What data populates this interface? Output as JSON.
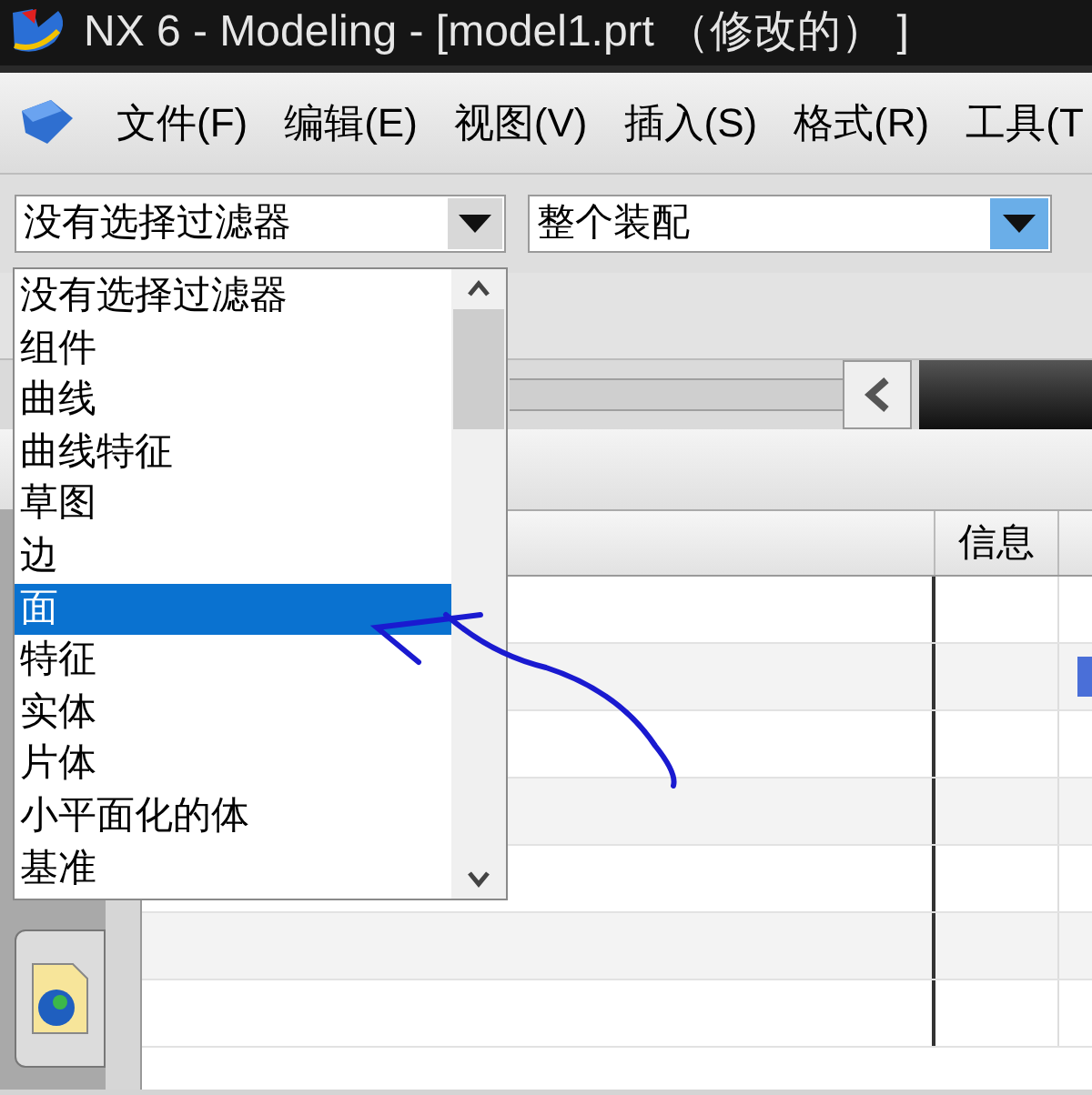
{
  "window": {
    "title": "NX 6 - Modeling - [model1.prt （修改的） ]"
  },
  "menu": [
    "文件(F)",
    "编辑(E)",
    "视图(V)",
    "插入(S)",
    "格式(R)",
    "工具(T"
  ],
  "filter_combo": {
    "value": "没有选择过滤器"
  },
  "scope_combo": {
    "value": "整个装配"
  },
  "filter_list": [
    {
      "label": "没有选择过滤器",
      "selected": false
    },
    {
      "label": "组件",
      "selected": false
    },
    {
      "label": "曲线",
      "selected": false
    },
    {
      "label": "曲线特征",
      "selected": false
    },
    {
      "label": "草图",
      "selected": false
    },
    {
      "label": "边",
      "selected": false
    },
    {
      "label": "面",
      "selected": true
    },
    {
      "label": "特征",
      "selected": false
    },
    {
      "label": "实体",
      "selected": false
    },
    {
      "label": "片体",
      "selected": false
    },
    {
      "label": "小平面化的体",
      "selected": false
    },
    {
      "label": "基准",
      "selected": false
    }
  ],
  "table": {
    "columns": [
      "信息"
    ],
    "row_count_marker": [
      false,
      true,
      false,
      false,
      false,
      false,
      false
    ]
  }
}
